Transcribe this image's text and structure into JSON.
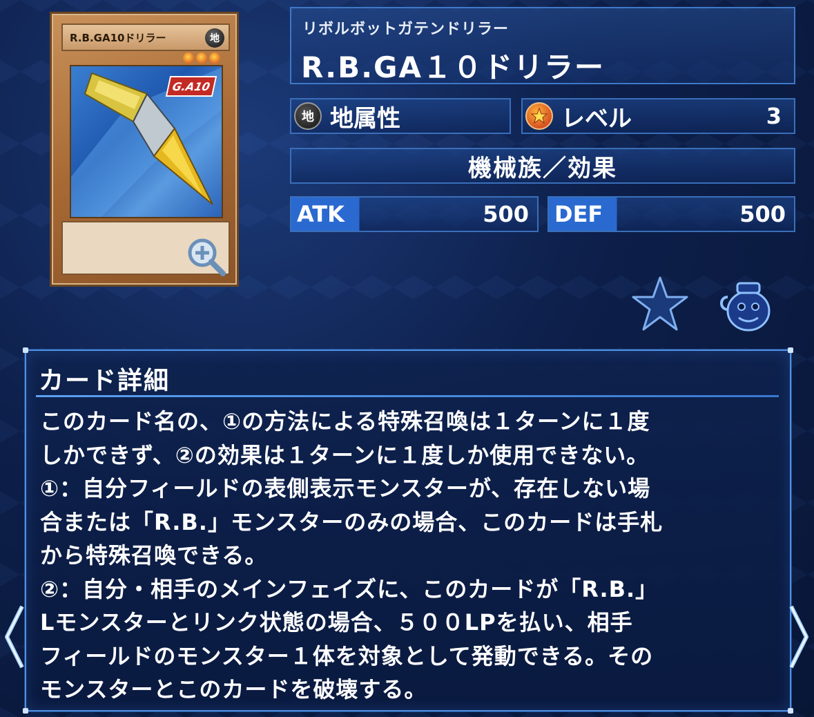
{
  "card": {
    "image_name_plate": "R.B.GA10ドリラー",
    "image_attr_glyph": "地",
    "image_badge": "G.A10",
    "ruby": "リボルボットガテンドリラー",
    "name": "R.B.GA１０ドリラー"
  },
  "stats": {
    "attribute_glyph": "地",
    "attribute": "地属性",
    "level_label": "レベル",
    "level_value": "3",
    "type": "機械族／効果",
    "atk_label": "ATK",
    "atk_value": "500",
    "def_label": "DEF",
    "def_value": "500"
  },
  "detail": {
    "title": "カード詳細",
    "lines": [
      "このカード名の、①の方法による特殊召喚は１ターンに１度",
      "しかできず、②の効果は１ターンに１度しか使用できない。",
      "①：自分フィールドの表側表示モンスターが、存在しない場",
      "合または「R.B.」モンスターのみの場合、このカードは手札",
      "から特殊召喚できる。",
      "②：自分・相手のメインフェイズに、このカードが「R.B.」",
      "Lモンスターとリンク状態の場合、５００LPを払い、相手",
      "フィールドのモンスター１体を対象として発動できる。その",
      "モンスターとこのカードを破壊する。"
    ]
  },
  "icons": {
    "zoom": "zoom-in-icon",
    "favorite": "star-icon",
    "pot": "pot-of-greed-icon",
    "prev": "chevron-left-icon",
    "next": "chevron-right-icon"
  },
  "colors": {
    "accent": "#3f78c8",
    "panel_border": "#4f8fe0",
    "stat_label_bg": "#2a6ad0",
    "card_frame": "#b07040"
  }
}
